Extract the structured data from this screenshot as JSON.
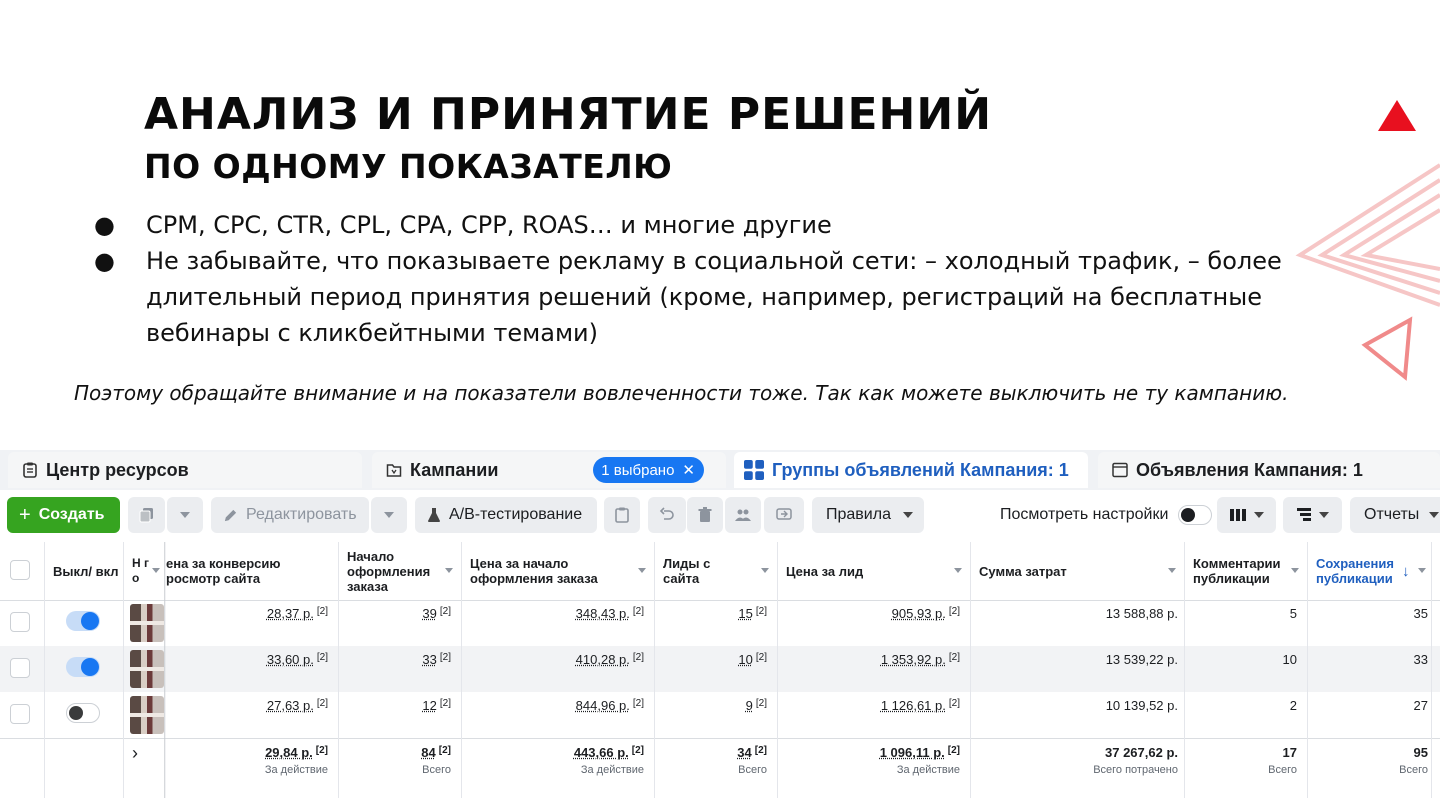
{
  "slide": {
    "title": "АНАЛИЗ И ПРИНЯТИЕ РЕШЕНИЙ",
    "subtitle": "ПО ОДНОМУ ПОКАЗАТЕЛЮ",
    "bullets": [
      "CPM, CPC, CTR, CPL, CPA, CPP, ROAS… и многие другие",
      "Не забывайте, что показываете рекламу в социальной сети: – холодный трафик, – более длительный период принятия решений (кроме, например, регистраций на бесплатные вебинары с кликбейтными темами)"
    ],
    "bullet_mark": "●",
    "note": "Поэтому обращайте внимание и на показатели вовлеченности тоже. Так как можете выключить не ту кампанию.",
    "accent_color": "#e8101f"
  },
  "ads_manager": {
    "tabs": {
      "resources": "Центр ресурсов",
      "campaigns": "Кампании",
      "selected_pill": "1 выбрано",
      "pill_close": "✕",
      "adsets": "Группы объявлений Кампания: 1",
      "ads": "Объявления Кампания: 1"
    },
    "toolbar": {
      "create": "Создать",
      "create_plus": "+",
      "edit": "Редактировать",
      "ab_test": "A/B-тестирование",
      "rules": "Правила",
      "view_settings": "Посмотреть настройки",
      "reports": "Отчеты"
    },
    "columns": {
      "toggle": "Выкл/ вкл",
      "name": "Н г о",
      "cost_per_conversion": "ена за конверсию росмотр сайта",
      "checkouts": "Начало оформления заказа",
      "cost_per_checkout": "Цена за начало оформления заказа",
      "leads": "Лиды с сайта",
      "cost_per_lead": "Цена за лид",
      "spend": "Сумма затрат",
      "comments": "Комментарии публикации",
      "saves": "Сохранения публикации",
      "sort_arrow": "↓"
    },
    "footnote": "[2]",
    "rows": [
      {
        "cpc": "28,37 р.",
        "checkouts": "39",
        "cpcheckout": "348,43 р.",
        "leads": "15",
        "cpl": "905,93 р.",
        "spend": "13 588,88 р.",
        "comments": "5",
        "saves": "35",
        "on": true
      },
      {
        "cpc": "33,60 р.",
        "checkouts": "33",
        "cpcheckout": "410,28 р.",
        "leads": "10",
        "cpl": "1 353,92 р.",
        "spend": "13 539,22 р.",
        "comments": "10",
        "saves": "33",
        "on": true
      },
      {
        "cpc": "27,63 р.",
        "checkouts": "12",
        "cpcheckout": "844,96 р.",
        "leads": "9",
        "cpl": "1 126,61 р.",
        "spend": "10 139,52 р.",
        "comments": "2",
        "saves": "27",
        "on": false
      }
    ],
    "totals": {
      "expand": "›",
      "cpc": "29,84 р.",
      "cpc_cap": "За действие",
      "checkouts": "84",
      "checkouts_cap": "Всего",
      "cpcheckout": "443,66 р.",
      "cpcheckout_cap": "За действие",
      "leads": "34",
      "leads_cap": "Всего",
      "cpl": "1 096,11 р.",
      "cpl_cap": "За действие",
      "spend": "37 267,62 р.",
      "spend_cap": "Всего потрачено",
      "comments": "17",
      "comments_cap": "Всего",
      "saves": "95",
      "saves_cap": "Всего"
    },
    "colors": {
      "primary_blue": "#1877f2",
      "create_green": "#36a420"
    }
  }
}
